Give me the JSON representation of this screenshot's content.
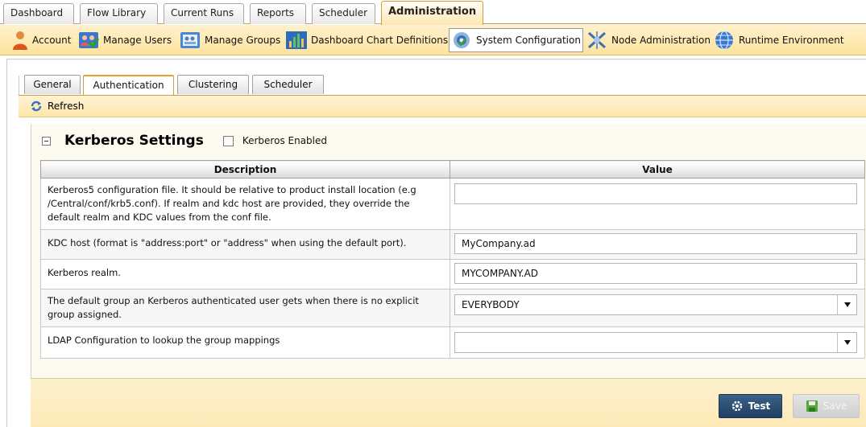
{
  "top_tabs": [
    {
      "label": "Dashboard"
    },
    {
      "label": "Flow Library"
    },
    {
      "label": "Current Runs"
    },
    {
      "label": "Reports"
    },
    {
      "label": "Scheduler"
    },
    {
      "label": "Administration",
      "active": true
    }
  ],
  "toolbar": {
    "items": [
      {
        "label": "Account",
        "icon": "account-icon"
      },
      {
        "label": "Manage Users",
        "icon": "manage-users-icon"
      },
      {
        "label": "Manage Groups",
        "icon": "manage-groups-icon"
      },
      {
        "label": "Dashboard Chart Definitions",
        "icon": "bar-chart-icon"
      },
      {
        "label": "System Configuration",
        "icon": "gear-icon",
        "active": true
      },
      {
        "label": "Node Administration",
        "icon": "node-icon"
      },
      {
        "label": "Runtime Environment",
        "icon": "globe-icon"
      }
    ]
  },
  "sub_tabs": [
    {
      "label": "General"
    },
    {
      "label": "Authentication",
      "active": true
    },
    {
      "label": "Clustering"
    },
    {
      "label": "Scheduler"
    }
  ],
  "refresh_label": "Refresh",
  "section": {
    "title": "Kerberos Settings",
    "enabled_label": "Kerberos Enabled",
    "enabled": false
  },
  "table": {
    "columns": [
      "Description",
      "Value"
    ],
    "rows": [
      {
        "description": "Kerberos5 configuration file. It should be relative to product install location (e.g /Central/conf/krb5.conf). If realm and kdc host are provided, they override the default realm and KDC values from the conf file.",
        "value": "",
        "type": "text"
      },
      {
        "description": "KDC host (format is \"address:port\" or \"address\" when using the default port).",
        "value": "MyCompany.ad",
        "type": "text"
      },
      {
        "description": "Kerberos realm.",
        "value": "MYCOMPANY.AD",
        "type": "text"
      },
      {
        "description": "The default group an Kerberos authenticated user gets when there is no explicit group assigned.",
        "value": "EVERYBODY",
        "type": "select"
      },
      {
        "description": "LDAP Configuration to lookup the group mappings",
        "value": "",
        "type": "select"
      }
    ]
  },
  "buttons": {
    "test": "Test",
    "save": "Save"
  }
}
